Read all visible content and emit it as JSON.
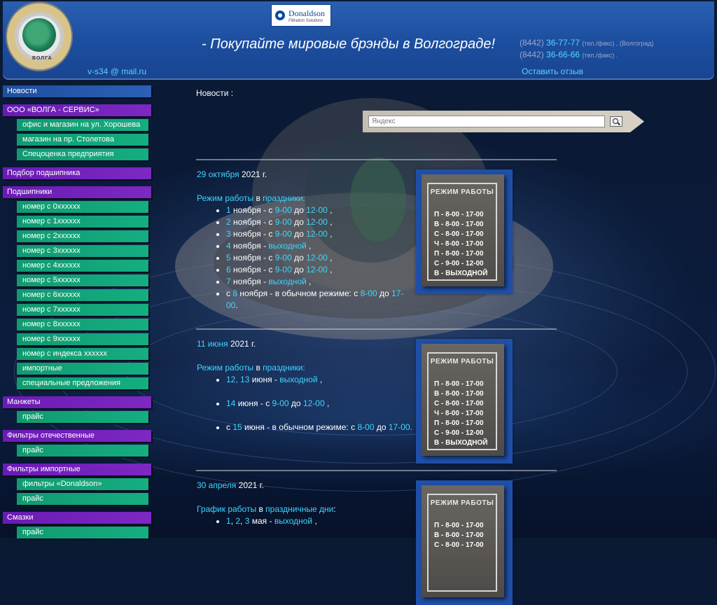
{
  "header": {
    "logo_text": "ВОЛГА",
    "brand": {
      "name": "Donaldson",
      "tagline": "Filtration Solutions"
    },
    "slogan": "-  Покупайте мировые брэнды в Волгограде!",
    "phones": [
      {
        "code": "(8442)",
        "number": "36-77-77",
        "note": "(тел./факс) , (Волгоград)"
      },
      {
        "code": "(8442)",
        "number": "36-66-66",
        "note": "(тел./факс) ."
      }
    ],
    "email": "v-s34 @ mail.ru",
    "review_link": "Оставить отзыв"
  },
  "sidebar": {
    "news": "Новости",
    "company": "ООО «ВОЛГА - СЕРВИС»",
    "company_items": [
      "офис и магазин на ул. Хорошева",
      "магазин на пр. Столетова",
      "Спецоценка предприятия"
    ],
    "bearing_select": "Подбор подшипника",
    "bearings": "Подшипники",
    "bearing_items": [
      "номер с 0xxxxxx",
      "номер с 1xxxxxx",
      "номер с 2xxxxxx",
      "номер с 3xxxxxx",
      "номер с 4xxxxxx",
      "номер с 5xxxxxx",
      "номер с 6xxxxxx",
      "номер с 7xxxxxx",
      "номер с 8xxxxxx",
      "номер с 9xxxxxx",
      "номер с индекса xxxxxx",
      "импортные",
      "специальные предложения"
    ],
    "cuffs": "Манжеты",
    "cuffs_items": [
      "прайс"
    ],
    "filters_dom": "Фильтры отечественные",
    "filters_dom_items": [
      "прайс"
    ],
    "filters_imp": "Фильтры импортные",
    "filters_imp_items": [
      "фильтры «Donaldson»",
      "прайс"
    ],
    "lubricants": "Смазки",
    "lubricants_items": [
      "прайс"
    ]
  },
  "main": {
    "title": "Новости :",
    "search": {
      "placeholder": "Яндекс"
    },
    "poster": {
      "title": "РЕЖИМ РАБОТЫ",
      "lines": [
        "П  -  8-00 - 17-00",
        "В  -  8-00 - 17-00",
        "С  -  8-00 - 17-00",
        "Ч  -  8-00 - 17-00",
        "П  -  8-00 - 17-00",
        "С  -  9-00 - 12-00",
        "В  -  ВЫХОДНОЙ"
      ]
    },
    "news": [
      {
        "date": "29 октября",
        "year": "2021 г.",
        "heading_a": "Режим работы",
        "heading_in": "в",
        "heading_b": "праздники",
        "items": [
          {
            "d": "1",
            "m": "ноября - с",
            "from": "9-00",
            "to_word": "до",
            "to": "12-00",
            "end": ","
          },
          {
            "d": "2",
            "m": "ноября - с",
            "from": "9-00",
            "to_word": "до",
            "to": "12-00",
            "end": ","
          },
          {
            "d": "3",
            "m": "ноября - с",
            "from": "9-00",
            "to_word": "до",
            "to": "12-00",
            "end": ","
          },
          {
            "d": "4",
            "m": "ноября -",
            "off": "выходной",
            "end": ","
          },
          {
            "d": "5",
            "m": "ноября - с",
            "from": "9-00",
            "to_word": "до",
            "to": "12-00",
            "end": ","
          },
          {
            "d": "6",
            "m": "ноября - с",
            "from": "9-00",
            "to_word": "до",
            "to": "12-00",
            "end": ","
          },
          {
            "d": "7",
            "m": "ноября -",
            "off": "выходной",
            "end": ","
          }
        ],
        "last": {
          "pre": "с",
          "d": "8",
          "text": "ноября - в обычном режиме: с",
          "from": "8-00",
          "to_word": "до",
          "to": "17-00",
          "end": "."
        }
      },
      {
        "date": "11 июня",
        "year": "2021 г.",
        "heading_a": "Режим работы",
        "heading_in": "в",
        "heading_b": "праздники",
        "l1": {
          "d1": "12",
          "d2": "13",
          "m": "июня",
          "off": "выходной",
          "end": ","
        },
        "l2": {
          "d": "14",
          "m": "июня - с",
          "from": "9-00",
          "to_word": "до",
          "to": "12-00",
          "end": ","
        },
        "l3": {
          "pre": "с",
          "d": "15",
          "text": "июня - в обычном режиме: с",
          "from": "8-00",
          "to_word": "до",
          "to": "17-00."
        }
      },
      {
        "date": "30 апреля",
        "year": "2021 г.",
        "heading_a": "График работы",
        "heading_in": "в",
        "heading_b": "праздничные дни",
        "l1": {
          "d1": "1",
          "d2": "2",
          "d3": "3",
          "m": "мая",
          "off": "выходной",
          "end": ","
        }
      }
    ]
  }
}
